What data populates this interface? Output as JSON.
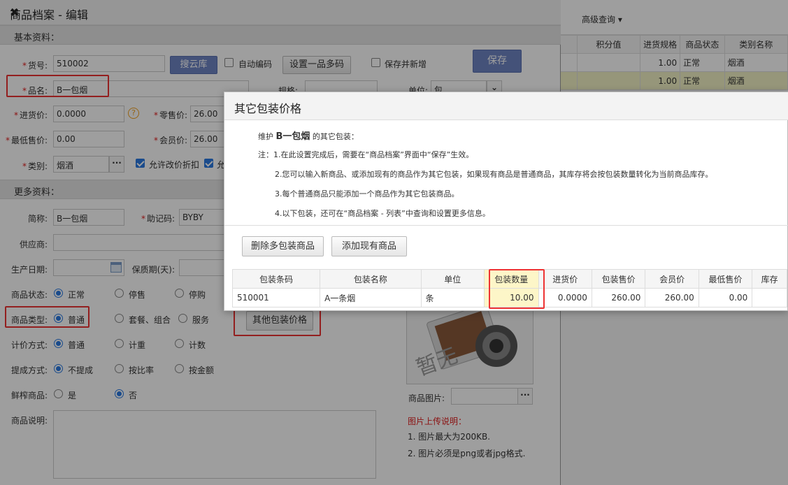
{
  "background_list": {
    "advanced_query": "高级查询",
    "headers": [
      "积分值",
      "进货规格",
      "商品状态",
      "类别名称"
    ],
    "rows": [
      {
        "points": "",
        "spec": "1.00",
        "status": "正常",
        "category": "烟酒"
      },
      {
        "points": "",
        "spec": "1.00",
        "status": "正常",
        "category": "烟酒"
      }
    ]
  },
  "edit_dialog": {
    "title": "商品档案 - 编辑",
    "section_basic": "基本资料：",
    "section_more": "更多资料：",
    "labels": {
      "code": "货号:",
      "name": "品名:",
      "purchase_price": "进货价:",
      "retail_price": "零售价:",
      "min_price": "最低售价:",
      "member_price": "会员价:",
      "category": "类别:",
      "spec": "规格:",
      "unit": "单位:",
      "short_name": "简称:",
      "mnemonic": "助记码:",
      "supplier": "供应商:",
      "production_date": "生产日期:",
      "shelf_life": "保质期(天):",
      "status": "商品状态:",
      "type": "商品类型:",
      "pricing": "计价方式:",
      "commission": "提成方式:",
      "fresh": "鲜榨商品:",
      "description": "商品说明:",
      "image": "商品图片:"
    },
    "values": {
      "code": "510002",
      "name": "B一包烟",
      "purchase_price": "0.0000",
      "retail_price": "26.00",
      "min_price": "0.00",
      "member_price": "26.00",
      "category": "烟酒",
      "unit": "包",
      "short_name": "B一包烟",
      "mnemonic": "BYBY"
    },
    "buttons": {
      "cloud": "搜云库",
      "multi_code": "设置一品多码",
      "save": "保存",
      "other_package": "其他包装价格",
      "dots": "···"
    },
    "checkboxes": {
      "auto_code": "自动编码",
      "save_new": "保存并新增",
      "allow_discount": "允许改价折扣",
      "allow_more": "允"
    },
    "status_options": [
      "正常",
      "停售",
      "停购"
    ],
    "type_options": [
      "普通",
      "套餐、组合",
      "服务"
    ],
    "pricing_options": [
      "普通",
      "计重",
      "计数"
    ],
    "commission_options": [
      "不提成",
      "按比率",
      "按金额"
    ],
    "fresh_options": [
      "是",
      "否"
    ],
    "image_notes": {
      "title": "图片上传说明：",
      "line1": "1. 图片最大为200KB.",
      "line2": "2. 图片必须是png或者jpg格式."
    },
    "image_placeholder": "暂无"
  },
  "package_dialog": {
    "title": "其它包装价格",
    "intro_prefix": "维护",
    "intro_product": "B一包烟",
    "intro_suffix": "的其它包装：",
    "notes": [
      "注：1.在此设置完成后，需要在“商品档案”界面中“保存”生效。",
      "2.您可以输入新商品、或添加现有的商品作为其它包装，如果现有商品是普通商品，其库存将会按包装数量转化为当前商品库存。",
      "3.每个普通商品只能添加一个商品作为其它包装商品。",
      "4.以下包装，还可在“商品档案 - 列表”中查询和设置更多信息。"
    ],
    "buttons": {
      "delete": "删除多包装商品",
      "add_existing": "添加现有商品"
    },
    "columns": [
      "包装条码",
      "包装名称",
      "单位",
      "包装数量",
      "进货价",
      "包装售价",
      "会员价",
      "最低售价",
      "库存"
    ],
    "rows": [
      [
        "510001",
        "A一条烟",
        "条",
        "10.00",
        "0.0000",
        "260.00",
        "260.00",
        "0.00",
        ""
      ]
    ]
  },
  "colors": {
    "accent_blue": "#6f85c4",
    "highlight_red": "#e33333",
    "highlight_yellow": "#fdf6c8"
  }
}
